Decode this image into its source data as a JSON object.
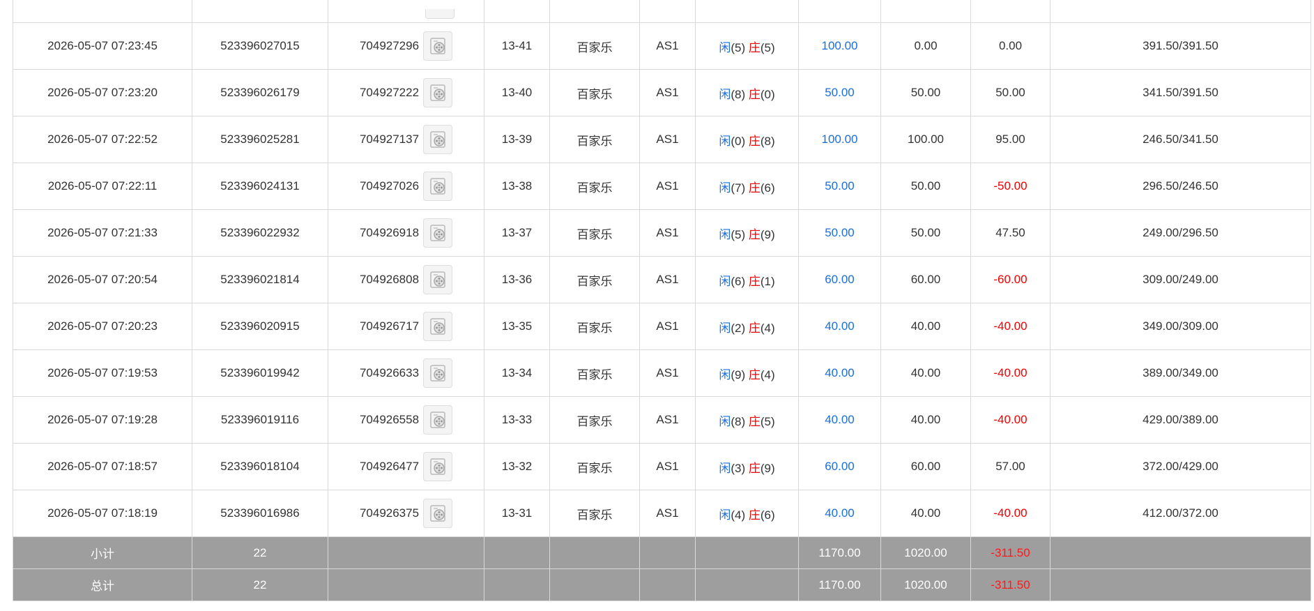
{
  "colors": {
    "player": "#1a6fe0",
    "banker": "#ee0000",
    "total_bg": "#9e9e9e"
  },
  "icons": {
    "replay": "film-reel-icon"
  },
  "labels": {
    "player": "闲",
    "banker": "庄"
  },
  "rows": [
    {
      "time": "2026-05-07 07:23:45",
      "order_id": "523396027015",
      "game_id": "704927296",
      "round": "13-41",
      "game": "百家乐",
      "table": "AS1",
      "player_pts": "(5)",
      "banker_pts": "(5)",
      "bet": "100.00",
      "valid_bet": "0.00",
      "win_loss": "0.00",
      "win_negative": false,
      "balance": "391.50/391.50"
    },
    {
      "time": "2026-05-07 07:23:20",
      "order_id": "523396026179",
      "game_id": "704927222",
      "round": "13-40",
      "game": "百家乐",
      "table": "AS1",
      "player_pts": "(8)",
      "banker_pts": "(0)",
      "bet": "50.00",
      "valid_bet": "50.00",
      "win_loss": "50.00",
      "win_negative": false,
      "balance": "341.50/391.50"
    },
    {
      "time": "2026-05-07 07:22:52",
      "order_id": "523396025281",
      "game_id": "704927137",
      "round": "13-39",
      "game": "百家乐",
      "table": "AS1",
      "player_pts": "(0)",
      "banker_pts": "(8)",
      "bet": "100.00",
      "valid_bet": "100.00",
      "win_loss": "95.00",
      "win_negative": false,
      "balance": "246.50/341.50"
    },
    {
      "time": "2026-05-07 07:22:11",
      "order_id": "523396024131",
      "game_id": "704927026",
      "round": "13-38",
      "game": "百家乐",
      "table": "AS1",
      "player_pts": "(7)",
      "banker_pts": "(6)",
      "bet": "50.00",
      "valid_bet": "50.00",
      "win_loss": "-50.00",
      "win_negative": true,
      "balance": "296.50/246.50"
    },
    {
      "time": "2026-05-07 07:21:33",
      "order_id": "523396022932",
      "game_id": "704926918",
      "round": "13-37",
      "game": "百家乐",
      "table": "AS1",
      "player_pts": "(5)",
      "banker_pts": "(9)",
      "bet": "50.00",
      "valid_bet": "50.00",
      "win_loss": "47.50",
      "win_negative": false,
      "balance": "249.00/296.50"
    },
    {
      "time": "2026-05-07 07:20:54",
      "order_id": "523396021814",
      "game_id": "704926808",
      "round": "13-36",
      "game": "百家乐",
      "table": "AS1",
      "player_pts": "(6)",
      "banker_pts": "(1)",
      "bet": "60.00",
      "valid_bet": "60.00",
      "win_loss": "-60.00",
      "win_negative": true,
      "balance": "309.00/249.00"
    },
    {
      "time": "2026-05-07 07:20:23",
      "order_id": "523396020915",
      "game_id": "704926717",
      "round": "13-35",
      "game": "百家乐",
      "table": "AS1",
      "player_pts": "(2)",
      "banker_pts": "(4)",
      "bet": "40.00",
      "valid_bet": "40.00",
      "win_loss": "-40.00",
      "win_negative": true,
      "balance": "349.00/309.00"
    },
    {
      "time": "2026-05-07 07:19:53",
      "order_id": "523396019942",
      "game_id": "704926633",
      "round": "13-34",
      "game": "百家乐",
      "table": "AS1",
      "player_pts": "(9)",
      "banker_pts": "(4)",
      "bet": "40.00",
      "valid_bet": "40.00",
      "win_loss": "-40.00",
      "win_negative": true,
      "balance": "389.00/349.00"
    },
    {
      "time": "2026-05-07 07:19:28",
      "order_id": "523396019116",
      "game_id": "704926558",
      "round": "13-33",
      "game": "百家乐",
      "table": "AS1",
      "player_pts": "(8)",
      "banker_pts": "(5)",
      "bet": "40.00",
      "valid_bet": "40.00",
      "win_loss": "-40.00",
      "win_negative": true,
      "balance": "429.00/389.00"
    },
    {
      "time": "2026-05-07 07:18:57",
      "order_id": "523396018104",
      "game_id": "704926477",
      "round": "13-32",
      "game": "百家乐",
      "table": "AS1",
      "player_pts": "(3)",
      "banker_pts": "(9)",
      "bet": "60.00",
      "valid_bet": "60.00",
      "win_loss": "57.00",
      "win_negative": false,
      "balance": "372.00/429.00"
    },
    {
      "time": "2026-05-07 07:18:19",
      "order_id": "523396016986",
      "game_id": "704926375",
      "round": "13-31",
      "game": "百家乐",
      "table": "AS1",
      "player_pts": "(4)",
      "banker_pts": "(6)",
      "bet": "40.00",
      "valid_bet": "40.00",
      "win_loss": "-40.00",
      "win_negative": true,
      "balance": "412.00/372.00"
    }
  ],
  "totals": [
    {
      "label": "小计",
      "count": "22",
      "bet": "1170.00",
      "valid_bet": "1020.00",
      "win_loss": "-311.50"
    },
    {
      "label": "总计",
      "count": "22",
      "bet": "1170.00",
      "valid_bet": "1020.00",
      "win_loss": "-311.50"
    }
  ]
}
